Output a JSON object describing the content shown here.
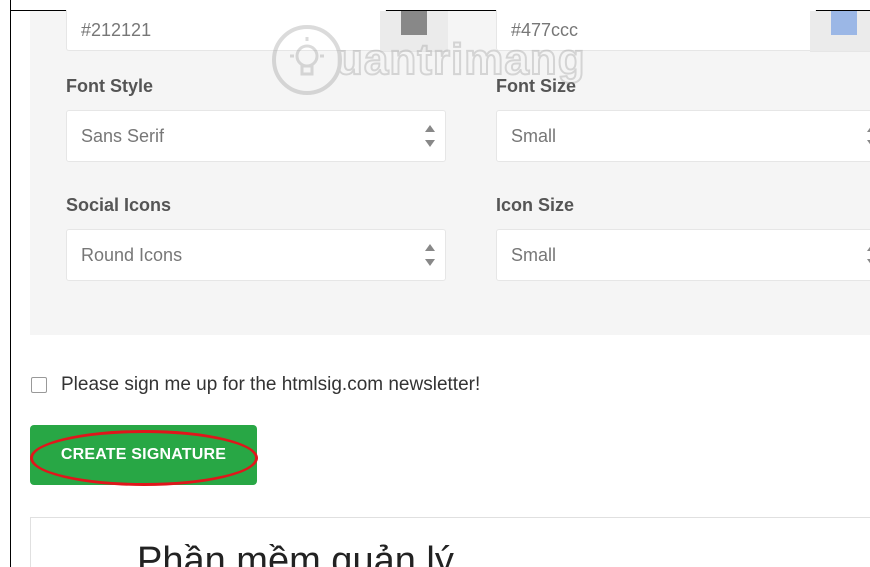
{
  "text_color": {
    "value": "#212121",
    "swatch_color": "#888888"
  },
  "link_color": {
    "value": "#477ccc",
    "swatch_color": "#9bb7e6"
  },
  "font_style": {
    "label": "Font Style",
    "selected": "Sans Serif"
  },
  "font_size": {
    "label": "Font Size",
    "selected": "Small"
  },
  "social_icons": {
    "label": "Social Icons",
    "selected": "Round Icons"
  },
  "icon_size": {
    "label": "Icon Size",
    "selected": "Small"
  },
  "watermark": {
    "text": "uantrimang"
  },
  "newsletter": {
    "label": "Please sign me up for the htmlsig.com newsletter!",
    "checked": false
  },
  "create_button": {
    "label": "CREATE SIGNATURE",
    "color": "#28a745",
    "highlight_color": "#e0161b"
  },
  "preview": {
    "heading": "Phần mềm quản lý"
  }
}
